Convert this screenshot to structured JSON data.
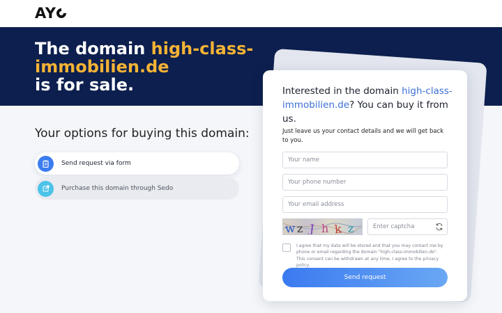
{
  "header": {
    "logo_text": "AY",
    "logo_icon": "ring-icon"
  },
  "hero": {
    "title_prefix": "The domain ",
    "domain": "high-class-immobilien.de",
    "title_suffix": "is for sale."
  },
  "options": {
    "title": "Your options for buying this domain:",
    "items": [
      {
        "label": "Send request via form",
        "icon": "clipboard-icon",
        "active": true
      },
      {
        "label": "Purchase this domain through Sedo",
        "icon": "external-link-icon",
        "active": false
      }
    ]
  },
  "form": {
    "title_prefix": "Interested in the domain ",
    "title_domain": "high-class-immobilien.de",
    "title_suffix": "? You can buy it from us.",
    "subtitle": "Just leave us your contact details and we will get back to you.",
    "name_placeholder": "Your name",
    "phone_placeholder": "Your phone number",
    "email_placeholder": "Your email address",
    "captcha_text": "wzJhkz",
    "captcha_placeholder": "Enter captcha",
    "consent_text": "I agree that my data will be stored and that you may contact me by phone or email regarding the domain \"high-class-immobilien.de\". This consent can be withdrawn at any time. I agree to the privacy policy.",
    "submit_label": "Send request"
  },
  "colors": {
    "hero_bg": "#0c1f4e",
    "highlight": "#f5b335",
    "accent": "#3b7cf0"
  }
}
